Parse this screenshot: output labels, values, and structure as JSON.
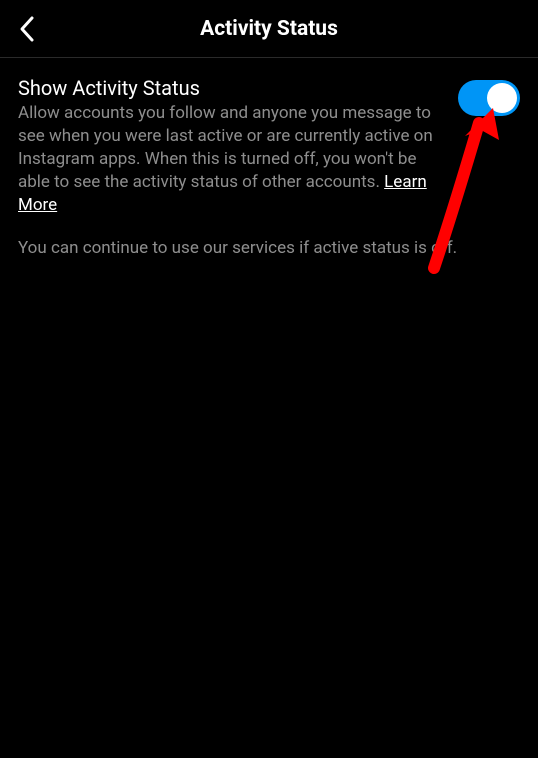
{
  "header": {
    "title": "Activity Status"
  },
  "setting": {
    "title": "Show Activity Status",
    "description": "Allow accounts you follow and anyone you message to see when you were last active or are currently active on Instagram apps. When this is turned off, you won't be able to see the activity status of other accounts. ",
    "learn_more": "Learn More",
    "continue_text": "You can continue to use our services if active status is off.",
    "toggle_on": true
  },
  "colors": {
    "toggle_active": "#0095f6",
    "arrow": "#ff0000"
  }
}
